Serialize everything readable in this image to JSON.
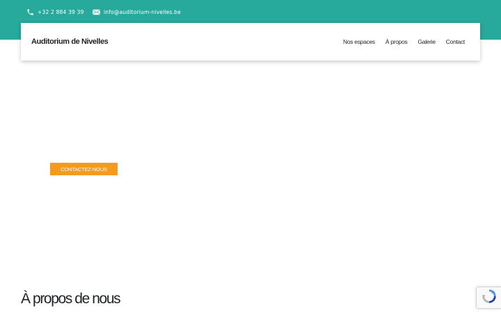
{
  "topbar": {
    "background": "#27a99c",
    "phone": {
      "icon": "phone-icon",
      "text": "+32 2 884 39 39"
    },
    "email": {
      "icon": "mail-icon",
      "text": "info@auditorium-nivelles.be"
    }
  },
  "navbar": {
    "brand": "Auditorium de Nivelles",
    "links": [
      "Nos espaces",
      "À propos",
      "Galerie",
      "Contact"
    ]
  },
  "hero": {
    "cta_label": "CONTACTEZ-NOUS",
    "cta_color": "#f49a1e"
  },
  "about": {
    "title": "À propos de nous"
  },
  "recaptcha": {
    "icon": "recaptcha-icon"
  }
}
